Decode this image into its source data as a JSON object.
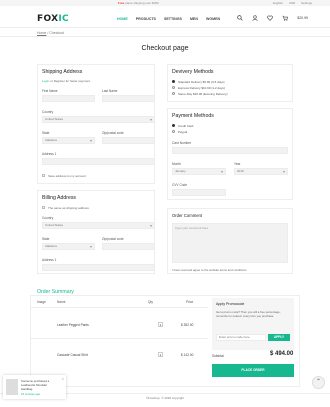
{
  "topbar": {
    "promo_prefix": "Free",
    "promo_text": "plane shipping over $250",
    "language": "English",
    "currency": "USD",
    "account": "Settings"
  },
  "header": {
    "logo_main": "FOX",
    "logo_accent": "IC",
    "nav": [
      "HOME",
      "PRODUCTS",
      "SETTINGS",
      "MEN",
      "WOMEN"
    ],
    "cart_total": "$20.99"
  },
  "breadcrumb": {
    "home": "Home",
    "current": "Checkout"
  },
  "page_title": "Checkout page",
  "shipping": {
    "title": "Shipping Address",
    "login_prefix": "Login",
    "login_text": "or Register for faster payment.",
    "first_name": "First Name",
    "last_name": "Last Name",
    "country_label": "Country",
    "country_value": "United States",
    "state_label": "State",
    "state_value": "Alabama",
    "zip_label": "Zip/postal code",
    "address_label": "Address 1",
    "save_label": "Save address to my account"
  },
  "billing": {
    "title": "Billing Address",
    "same_label": "The same as shipping address",
    "country_label": "Country",
    "country_value": "United States",
    "state_label": "State",
    "state_value": "Alabama",
    "zip_label": "Zip/postal code",
    "address_label": "Address 1"
  },
  "delivery": {
    "title": "Devivery Methods",
    "options": [
      "Standard Delivery $5.99 (3-5 days)",
      "Express Delivery $10.99 (1-2 days)",
      "Same-Day $20.00 (Evening Delivery)"
    ],
    "selected": 0
  },
  "payment": {
    "title": "Payment Methods",
    "options": [
      "Credit Card",
      "Paypal"
    ],
    "selected": 0,
    "card_number_label": "Card Number",
    "month_label": "Month",
    "month_value": "January",
    "year_label": "Year",
    "year_value": "2019",
    "cvv_label": "CVV Code"
  },
  "order_comment": {
    "title": "Order Comment",
    "placeholder": "Type your comment here",
    "agree_text": "I have read and agree to the website terms and conditions"
  },
  "summary": {
    "title": "Order Summary",
    "headers": [
      "Image",
      "Name",
      "Qty",
      "Price"
    ],
    "items": [
      {
        "name": "Leather Pegged Pants",
        "qty": "1",
        "price": "$ 352.00"
      },
      {
        "name": "Cascade Casual Shirt",
        "qty": "1",
        "price": "$ 142.00"
      }
    ],
    "promo_title": "Apply Promocode",
    "promo_text": "Get a promo code? Then you will a free percentage, remember to redeem every time you purchase.",
    "promo_placeholder": "Enter promo code here",
    "apply_label": "APPLY",
    "subtotal_label": "Subtotal",
    "subtotal_value": "$ 494.00",
    "place_order_label": "PLACE ORDER"
  },
  "footer": {
    "copyright": "©Foxshop. © 2020 copyright"
  },
  "popup": {
    "line1": "Someone purchased a",
    "line2": "Leatherette Shoulder",
    "line3": "Handbag",
    "line4": "15 minutes ago"
  },
  "colors": {
    "accent": "#17b890",
    "promo": "#e53935"
  }
}
